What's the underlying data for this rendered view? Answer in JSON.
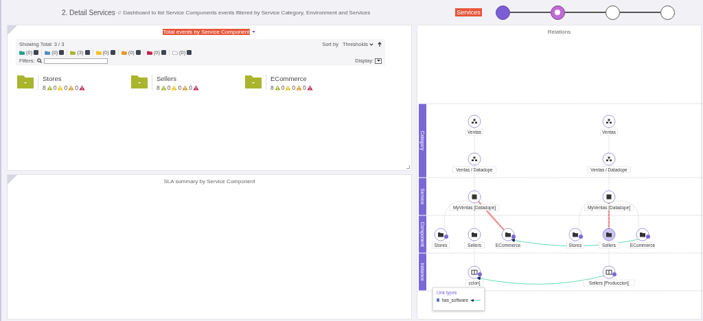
{
  "header": {
    "title": "2. Detail Services",
    "separator": "//",
    "description": "Dashboard to list Service Components events filtered by Service Category, Environment and Services"
  },
  "stepper": {
    "label": "Services",
    "steps": [
      {
        "completed": true,
        "selected": false
      },
      {
        "completed": false,
        "selected": true
      },
      {
        "completed": false,
        "selected": false
      },
      {
        "completed": false,
        "selected": false
      }
    ]
  },
  "events_panel": {
    "title": "Total events by Service Component",
    "showing": "Showing Total: 3 / 3",
    "chips": [
      {
        "color": "#1a9e86",
        "count": "(0)",
        "checked": true
      },
      {
        "color": "#4f8cbf",
        "count": "(0)",
        "checked": true
      },
      {
        "color": "#a9b52c",
        "count": "(3)",
        "checked": true
      },
      {
        "color": "#f2c21b",
        "count": "(0)",
        "checked": true
      },
      {
        "color": "#e2962a",
        "count": "(0)",
        "checked": true
      },
      {
        "color": "#c0234b",
        "count": "(0)",
        "checked": true
      },
      {
        "color": "#ffffff",
        "count": "(0)",
        "checked": true
      }
    ],
    "sort_label": "Sort by",
    "sort_value": "Thresholds",
    "filters_label": "Filters:",
    "display_label": "Display:",
    "cards": [
      {
        "name": "Stores",
        "color": "#a9b52c",
        "counts": [
          {
            "value": "8",
            "color": "#a9b52c"
          },
          {
            "value": "0",
            "color": "#f2c21b"
          },
          {
            "value": "0",
            "color": "#e2962a"
          },
          {
            "value": "0",
            "color": "#c0234b"
          }
        ]
      },
      {
        "name": "Sellers",
        "color": "#a9b52c",
        "counts": [
          {
            "value": "8",
            "color": "#a9b52c"
          },
          {
            "value": "0",
            "color": "#f2c21b"
          },
          {
            "value": "0",
            "color": "#e2962a"
          },
          {
            "value": "0",
            "color": "#c0234b"
          }
        ]
      },
      {
        "name": "ECommerce",
        "color": "#a9b52c",
        "counts": [
          {
            "value": "8",
            "color": "#a9b52c"
          },
          {
            "value": "0",
            "color": "#f2c21b"
          },
          {
            "value": "0",
            "color": "#e2962a"
          },
          {
            "value": "0",
            "color": "#c0234b"
          }
        ]
      }
    ]
  },
  "sla_panel": {
    "title": "SLA summary by Service Component"
  },
  "relations": {
    "title": "Relations",
    "lanes": [
      {
        "label": "Category"
      },
      {
        "label": "Service"
      },
      {
        "label": "Component"
      },
      {
        "label": "Instance"
      }
    ],
    "groups": [
      {
        "categories": [
          {
            "label": "Ventas"
          },
          {
            "label": "Ventas / Datadope"
          }
        ],
        "service": {
          "label": "MyVentas [Datadope]"
        },
        "components": [
          {
            "label": "Stores",
            "badge": true,
            "selected": false,
            "critical": false,
            "linked": false
          },
          {
            "label": "Sellers",
            "badge": false,
            "selected": false,
            "critical": false,
            "linked": false
          },
          {
            "label": "ECommerce",
            "badge": true,
            "selected": false,
            "critical": true,
            "linked": true
          }
        ],
        "instance": {
          "label": "ccion]",
          "badge": true,
          "linked": true
        }
      },
      {
        "categories": [
          {
            "label": "Ventas"
          },
          {
            "label": "Ventas / Datadope"
          }
        ],
        "service": {
          "label": "MyVentas [Datadope]"
        },
        "components": [
          {
            "label": "Stores",
            "badge": true,
            "selected": false,
            "critical": false,
            "linked": false
          },
          {
            "label": "Sellers",
            "badge": false,
            "selected": true,
            "critical": true,
            "linked": false
          },
          {
            "label": "ECommerce",
            "badge": true,
            "selected": false,
            "critical": false,
            "linked": true
          }
        ],
        "instance": {
          "label": "Sellers [Produccion]",
          "badge": true,
          "linked": true
        }
      }
    ],
    "legend": {
      "title": "Link types",
      "items": [
        {
          "label": "has_software",
          "checked": true
        }
      ]
    }
  }
}
